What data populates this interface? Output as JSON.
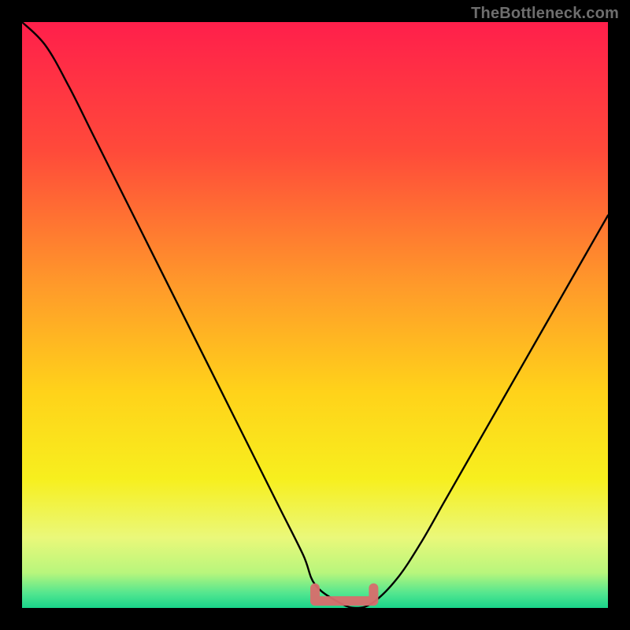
{
  "watermark": "TheBottleneck.com",
  "chart_data": {
    "type": "line",
    "title": "",
    "xlabel": "",
    "ylabel": "",
    "xlim": [
      0,
      100
    ],
    "ylim": [
      0,
      100
    ],
    "grid": false,
    "legend": false,
    "background_gradient_stops": [
      {
        "offset": 0.0,
        "color": "#ff1f4b"
      },
      {
        "offset": 0.22,
        "color": "#ff4a3a"
      },
      {
        "offset": 0.45,
        "color": "#ff9a2a"
      },
      {
        "offset": 0.63,
        "color": "#ffd21a"
      },
      {
        "offset": 0.78,
        "color": "#f7ef1e"
      },
      {
        "offset": 0.88,
        "color": "#eaf87a"
      },
      {
        "offset": 0.94,
        "color": "#b8f67c"
      },
      {
        "offset": 0.975,
        "color": "#52e68f"
      },
      {
        "offset": 1.0,
        "color": "#19d48a"
      }
    ],
    "series": [
      {
        "name": "bottleneck-curve",
        "x": [
          0,
          4,
          8,
          12,
          16,
          20,
          24,
          28,
          32,
          36,
          40,
          44,
          48,
          50,
          54,
          57,
          60,
          64,
          68,
          72,
          76,
          80,
          84,
          88,
          92,
          96,
          100
        ],
        "y": [
          100,
          96,
          89,
          81,
          73,
          65,
          57,
          49,
          41,
          33,
          25,
          17,
          9,
          4,
          1,
          0,
          1,
          5,
          11,
          18,
          25,
          32,
          39,
          46,
          53,
          60,
          67
        ]
      }
    ],
    "flat_region": {
      "x_start": 50,
      "x_end": 60,
      "y": 1.2
    }
  }
}
